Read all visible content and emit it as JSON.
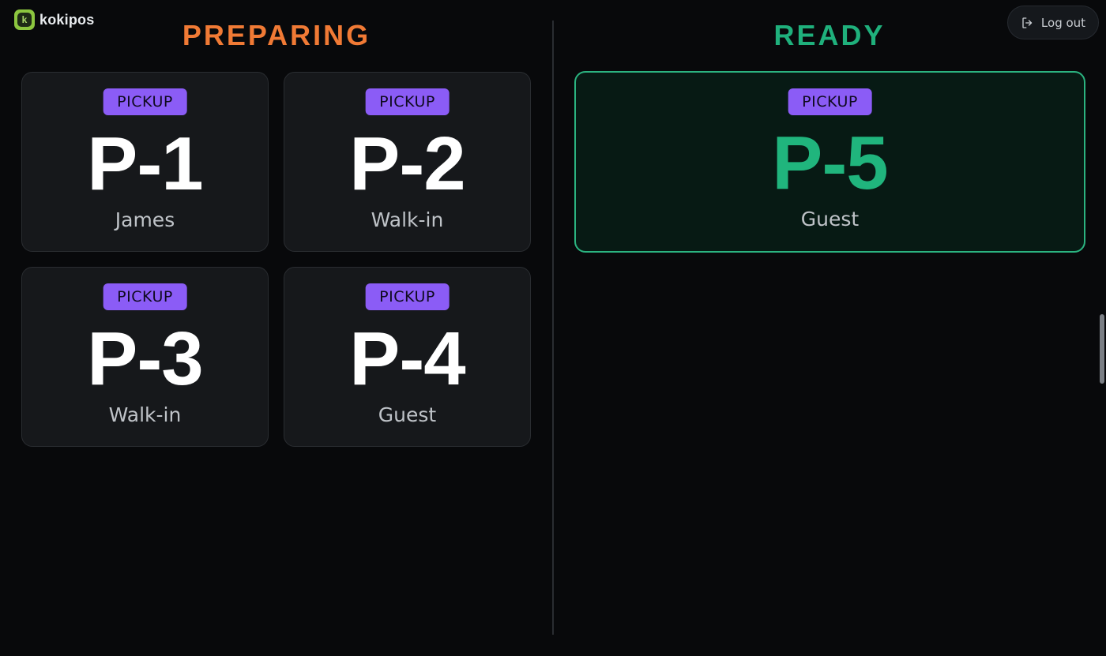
{
  "brand": {
    "name": "kokipos",
    "icon": "k-logo-icon",
    "accent": "#8cc63f"
  },
  "header": {
    "logout_label": "Log out",
    "logout_icon": "logout-icon"
  },
  "columns": {
    "preparing": {
      "title": "PREPARING",
      "color": "#f07a35"
    },
    "ready": {
      "title": "READY",
      "color": "#1fb07c"
    }
  },
  "orders": {
    "preparing": [
      {
        "type": "PICKUP",
        "number": "P-1",
        "customer": "James"
      },
      {
        "type": "PICKUP",
        "number": "P-2",
        "customer": "Walk-in"
      },
      {
        "type": "PICKUP",
        "number": "P-3",
        "customer": "Walk-in"
      },
      {
        "type": "PICKUP",
        "number": "P-4",
        "customer": "Guest"
      }
    ],
    "ready": [
      {
        "type": "PICKUP",
        "number": "P-5",
        "customer": "Guest"
      }
    ]
  },
  "colors": {
    "badge": "#8b5cf6",
    "background": "#08090b",
    "card": "#16181b",
    "ready_border": "#2bb380"
  }
}
